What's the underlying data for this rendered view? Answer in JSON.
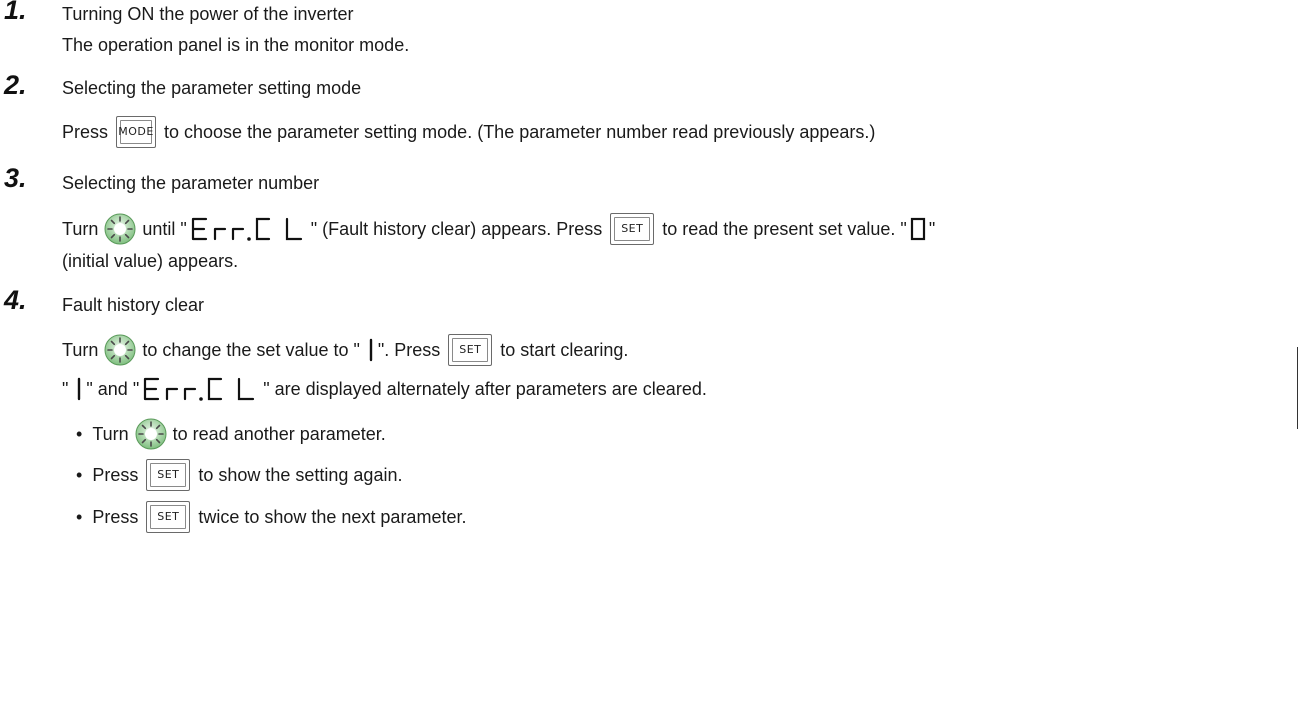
{
  "steps": [
    {
      "number": "1.",
      "title": "Turning ON the power of the inverter",
      "body": "The operation panel is in the monitor mode."
    },
    {
      "number": "2.",
      "title": "Selecting the parameter setting mode",
      "press_word": "Press",
      "mode_key_label": "MODE",
      "body_after_key": "to choose the parameter setting mode. (The parameter number read previously appears.)"
    },
    {
      "number": "3.",
      "title": "Selecting the parameter number",
      "turn_word": "Turn",
      "until_text": "until \"",
      "fault_clear_text": " \" (Fault history clear) appears. Press",
      "set_key_label": "SET",
      "read_text": "to read the present set value. \"",
      "quote_close": " \"",
      "initial_value_text": "(initial value) appears."
    },
    {
      "number": "4.",
      "title": "Fault history clear",
      "turn_word": "Turn",
      "change_text": "to change the set value to \"",
      "press_text": "\". Press",
      "set_key_label": "SET",
      "start_text": "to start clearing.",
      "alt_quote_open": "\"",
      "alt_and_text": "\" and \"",
      "alt_end_text": " \" are displayed alternately after parameters are cleared."
    }
  ],
  "bullets": [
    {
      "bullet": "•",
      "lead": "Turn",
      "tail": "to read another parameter."
    },
    {
      "bullet": "•",
      "lead": "Press",
      "key": "SET",
      "tail": "to show the setting again."
    },
    {
      "bullet": "•",
      "lead": "Press",
      "key": "SET",
      "tail": "twice to show the next parameter."
    }
  ],
  "display": {
    "err_cl": "Err.CL",
    "zero": "0",
    "one": "1"
  },
  "icons": {
    "dial": "setting-dial-icon",
    "lcd": "seven-segment-display"
  }
}
